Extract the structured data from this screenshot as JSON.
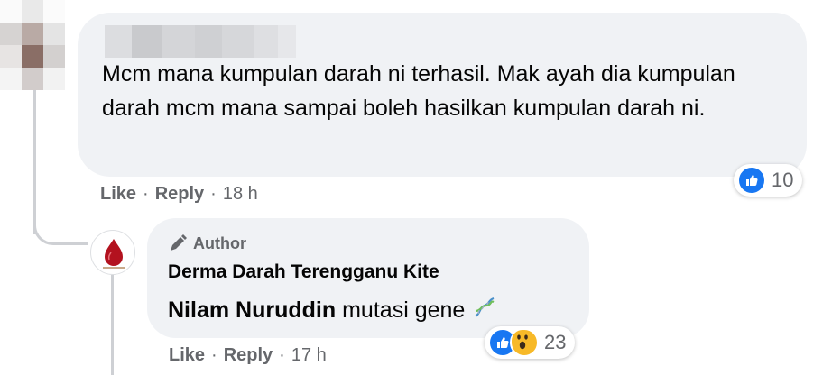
{
  "comment": {
    "text": "Mcm mana kumpulan darah ni terhasil. Mak ayah dia kumpulan darah mcm mana sampai boleh hasilkan kumpulan darah ni.",
    "actions": {
      "like": "Like",
      "reply": "Reply",
      "separator": "·",
      "time": "18 h"
    },
    "reactions": {
      "icons": [
        "like-icon"
      ],
      "count": "10"
    }
  },
  "reply": {
    "author_badge": "Author",
    "page_name": "Derma Darah Terengganu Kite",
    "tagged_name": "Nilam Nuruddin",
    "text": "mutasi gene",
    "emoji": "dna-icon",
    "actions": {
      "like": "Like",
      "reply": "Reply",
      "separator": "·",
      "time": "17 h"
    },
    "reactions": {
      "icons": [
        "like-icon",
        "wow-icon"
      ],
      "count": "23"
    }
  },
  "colors": {
    "bubble": "#f0f2f5",
    "secondary_text": "#65676b",
    "like_blue": "#1877f2",
    "wow_yellow": "#f7b928",
    "thread_line": "#ced0d4"
  }
}
